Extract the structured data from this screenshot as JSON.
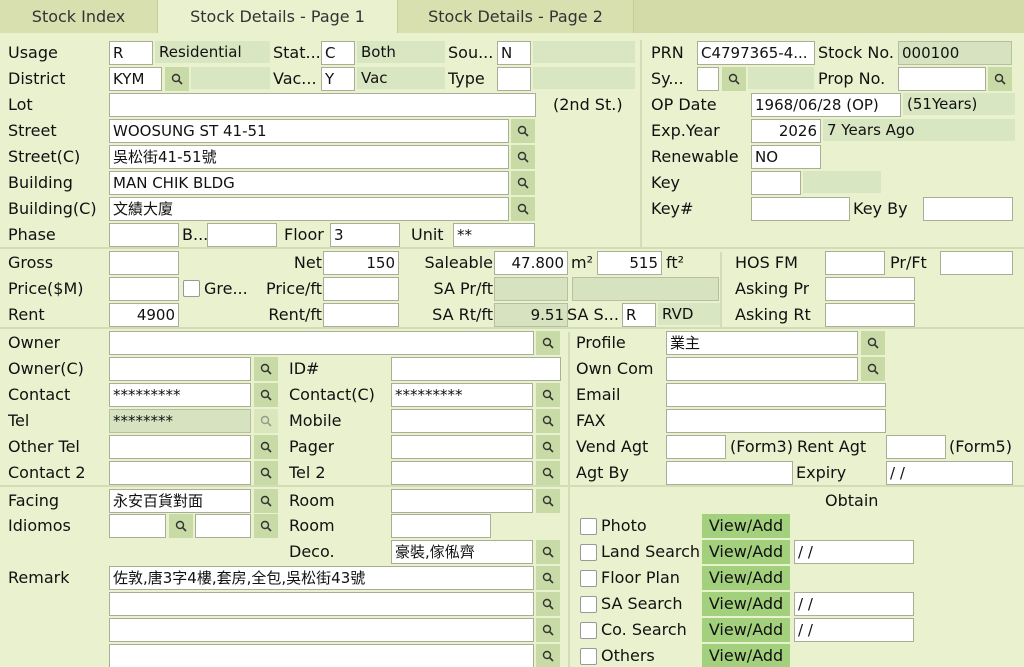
{
  "tabs": [
    "Stock Index",
    "Stock Details - Page 1",
    "Stock Details - Page 2"
  ],
  "f": {
    "usage_lbl": "Usage",
    "usage": "R",
    "usage_desc": "Residential",
    "status_lbl": "Stat...",
    "status": "C",
    "status_desc": "Both",
    "source_lbl": "Sou...",
    "source": "N",
    "prn_lbl": "PRN",
    "prn": "C4797365-4...",
    "stockno_lbl": "Stock No.",
    "stockno": "000100",
    "district_lbl": "District",
    "district": "KYM",
    "vac_lbl": "Vac...",
    "vac": "Y",
    "vac_desc": "Vac",
    "type_lbl": "Type",
    "sy_lbl": "Sy...",
    "propno_lbl": "Prop No.",
    "lot_lbl": "Lot",
    "lot_note": "(2nd St.)",
    "opdate_lbl": "OP Date",
    "opdate": "1968/06/28 (OP)",
    "opdate_desc": "(51Years)",
    "street_lbl": "Street",
    "street": "WOOSUNG ST 41-51",
    "expyear_lbl": "Exp.Year",
    "expyear": "2026",
    "expyear_desc": "7 Years Ago",
    "streetc_lbl": "Street(C)",
    "streetc": "吳松街41-51號",
    "renewable_lbl": "Renewable",
    "renewable": "NO",
    "building_lbl": "Building",
    "building": "MAN CHIK BLDG",
    "key_lbl": "Key",
    "buildingc_lbl": "Building(C)",
    "buildingc": "文績大廈",
    "keyno_lbl": "Key#",
    "keyby_lbl": "Key By",
    "phase_lbl": "Phase",
    "block_lbl": "B...",
    "floor_lbl": "Floor",
    "floor": "3",
    "unit_lbl": "Unit",
    "unit": "**",
    "gross_lbl": "Gross",
    "net_lbl": "Net",
    "net": "150",
    "saleable_lbl": "Saleable",
    "saleable_m2": "47.800",
    "m2": "m²",
    "saleable_ft2": "515",
    "ft2": "ft²",
    "hosfm_lbl": "HOS FM",
    "prft_lbl": "Pr/Ft",
    "price_lbl": "Price($M)",
    "gre_lbl": "Gre...",
    "priceft_lbl": "Price/ft",
    "saprft_lbl": "SA Pr/ft",
    "askingpr_lbl": "Asking Pr",
    "rent_lbl": "Rent",
    "rent": "4900",
    "rentft_lbl": "Rent/ft",
    "sartft_lbl": "SA Rt/ft",
    "sartft": "9.51",
    "sas_lbl": "SA S...",
    "sas": "R",
    "sas_desc": "RVD",
    "askingrt_lbl": "Asking Rt",
    "owner_lbl": "Owner",
    "profile_lbl": "Profile",
    "profile": "業主",
    "ownerc_lbl": "Owner(C)",
    "id_lbl": "ID#",
    "owncom_lbl": "Own Com",
    "contact_lbl": "Contact",
    "contact": "*********",
    "contactc_lbl": "Contact(C)",
    "contactc": "*********",
    "email_lbl": "Email",
    "tel_lbl": "Tel",
    "tel": "********",
    "mobile_lbl": "Mobile",
    "fax_lbl": "FAX",
    "othertel_lbl": "Other Tel",
    "pager_lbl": "Pager",
    "vendagt_lbl": "Vend Agt",
    "form3": "(Form3)",
    "rentagt_lbl": "Rent Agt",
    "form5": "(Form5)",
    "contact2_lbl": "Contact 2",
    "tel2_lbl": "Tel 2",
    "agtby_lbl": "Agt By",
    "expiry_lbl": "Expiry",
    "expiry": "/ /",
    "facing_lbl": "Facing",
    "facing": "永安百貨對面",
    "room_lbl": "Room",
    "obtain_lbl": "Obtain",
    "idiomos_lbl": "Idiomos",
    "room2_lbl": "Room",
    "deco_lbl": "Deco.",
    "deco": "豪裝,傢俬齊",
    "remark_lbl": "Remark",
    "remark": "佐敦,唐3字4樓,套房,全包,吳松街43號",
    "photo_lbl": "Photo",
    "landsearch_lbl": "Land Search",
    "floorplan_lbl": "Floor Plan",
    "sasearch_lbl": "SA Search",
    "cosearch_lbl": "Co. Search",
    "others_lbl": "Others",
    "view_add": "View/Add",
    "date_blank": "/ /"
  }
}
